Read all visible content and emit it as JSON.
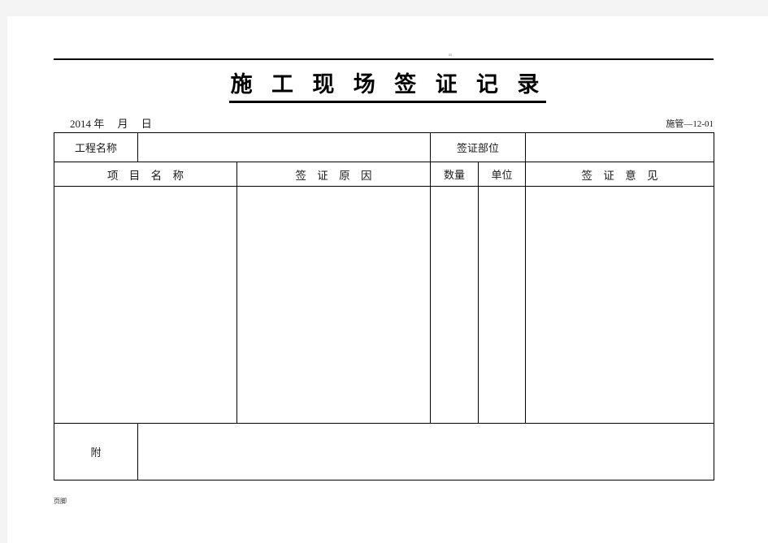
{
  "document": {
    "title": "施 工 现 场 签 证 记 录",
    "header_rule": true,
    "meta": {
      "date_line": "2014 年     月     日",
      "form_code": "施管—12-01"
    },
    "table": {
      "row1": {
        "project_name_label": "工程名称",
        "project_name_value": "",
        "signature_location_label": "签证部位",
        "signature_location_value": ""
      },
      "row2_headers": {
        "item_name": "项 目 名 称",
        "reason": "签 证 原 因",
        "quantity": "数量",
        "unit": "单位",
        "opinion": "签 证 意 见"
      },
      "row3_body": {
        "item_name": "",
        "reason": "",
        "quantity": "",
        "unit": "",
        "opinion": ""
      },
      "row4_attachment": {
        "label": "附",
        "value": ""
      }
    },
    "footer_text": "页脚"
  }
}
